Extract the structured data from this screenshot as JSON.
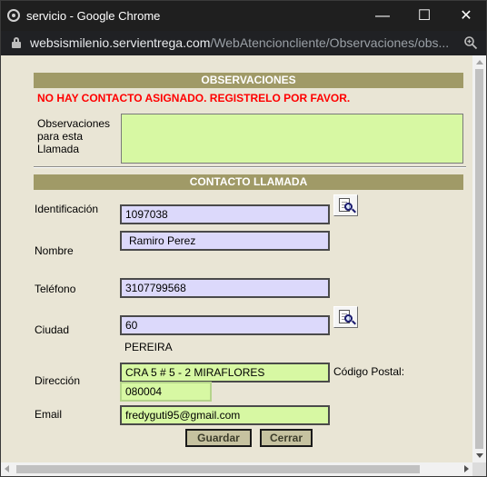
{
  "window": {
    "title": "servicio - Google Chrome",
    "minimize_glyph": "—",
    "maximize_glyph": "☐",
    "close_glyph": "✕"
  },
  "address_bar": {
    "domain": "websismilenio.servientrega.com",
    "path": "/WebAtencioncliente/Observaciones/obs..."
  },
  "observaciones": {
    "header": "OBSERVACIONES",
    "warning": "NO HAY CONTACTO ASIGNADO. REGISTRELO POR FAVOR.",
    "label": "Observaciones para esta Llamada",
    "value": ""
  },
  "contacto": {
    "header": "CONTACTO LLAMADA",
    "identificacion_label": "Identificación",
    "identificacion_value": "1097038",
    "nombre_label": "Nombre",
    "nombre_value": "Ramiro Perez",
    "telefono_label": "Teléfono",
    "telefono_value": "3107799568",
    "ciudad_label": "Ciudad",
    "ciudad_value": "60",
    "ciudad_name": "PEREIRA",
    "direccion_label": "Dirección",
    "direccion_value": "CRA 5 # 5 - 2 MIRAFLORES",
    "codigo_postal_label": "Código Postal:",
    "codigo_postal_value": "080004",
    "email_label": "Email",
    "email_value": "fredyguti95@gmail.com"
  },
  "buttons": {
    "guardar": "Guardar",
    "cerrar": "Cerrar"
  },
  "colors": {
    "header_bg": "#a09a67",
    "warning": "#ff0000",
    "input_purple": "#dcd9fb",
    "input_green": "#d7f8a3",
    "page_bg": "#e9e5d5"
  }
}
